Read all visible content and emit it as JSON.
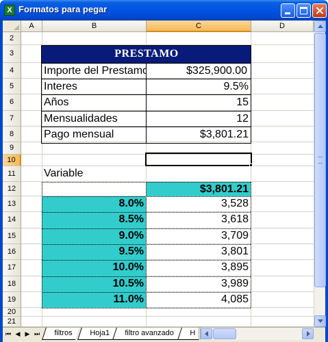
{
  "window": {
    "title": "Formatos para pegar",
    "app_icon_glyph": "X",
    "app_icon": "excel-workbook-icon",
    "buttons": [
      "minimize-icon",
      "maximize-icon",
      "close-icon"
    ],
    "title_bar_color": "#0054e3"
  },
  "columns": [
    "A",
    "B",
    "C",
    "D"
  ],
  "selected_column": "C",
  "rows": [
    "2",
    "3",
    "4",
    "5",
    "6",
    "7",
    "8",
    "9",
    "10",
    "11",
    "12",
    "13",
    "14",
    "15",
    "16",
    "17",
    "18",
    "19",
    "20",
    "21"
  ],
  "selected_row": "10",
  "loan": {
    "title": "PRESTAMO",
    "title_bg": "#091b7a",
    "items": [
      {
        "label": "Importe del Prestamo",
        "value": "$325,900.00"
      },
      {
        "label": "Interes",
        "value": "9.5%"
      },
      {
        "label": "Años",
        "value": "15"
      },
      {
        "label": "Mensualidades",
        "value": "12"
      },
      {
        "label": "Pago mensual",
        "value": "$3,801.21"
      }
    ]
  },
  "table": {
    "label": "Variable",
    "header_value": "$3,801.21",
    "accent": "#33cccc",
    "rows": [
      {
        "rate": "8.0%",
        "payment": "3,528"
      },
      {
        "rate": "8.5%",
        "payment": "3,618"
      },
      {
        "rate": "9.0%",
        "payment": "3,709"
      },
      {
        "rate": "9.5%",
        "payment": "3,801"
      },
      {
        "rate": "10.0%",
        "payment": "3,895"
      },
      {
        "rate": "10.5%",
        "payment": "3,989"
      },
      {
        "rate": "11.0%",
        "payment": "4,085"
      }
    ]
  },
  "tabs": {
    "nav": [
      "⏮",
      "◀",
      "▶",
      "⏭"
    ],
    "sheets": [
      "filtros",
      "Hoja1",
      "filtro avanzado",
      "H"
    ]
  }
}
